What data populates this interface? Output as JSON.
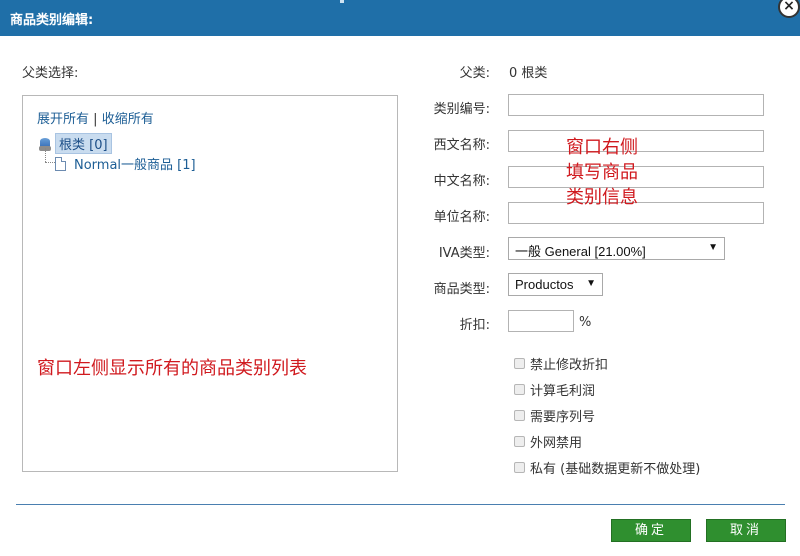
{
  "window": {
    "title": "商品类别编辑:",
    "close_label": "×"
  },
  "left": {
    "parent_select_label": "父类选择:",
    "expand_all": "展开所有",
    "separator": "|",
    "collapse_all": "收缩所有",
    "tree": {
      "root_label": "根类 [0]",
      "children": [
        {
          "label": "Normal一般商品 [1]"
        }
      ]
    },
    "note": "窗口左侧显示所有的商品类别列表"
  },
  "form": {
    "parent_label": "父类:",
    "parent_value": "0 根类",
    "code_label": "类别编号:",
    "code_value": "",
    "western_name_label": "西文名称:",
    "western_name_value": "",
    "chinese_name_label": "中文名称:",
    "chinese_name_value": "",
    "unit_label": "单位名称:",
    "unit_value": "",
    "iva_label": "IVA类型:",
    "iva_selected": "一般 General [21.00%]",
    "product_type_label": "商品类型:",
    "product_type_selected": "Productos",
    "discount_label": "折扣:",
    "discount_value": "",
    "percent_sign": "%",
    "note_line1": "窗口右侧",
    "note_line2": "填写商品",
    "note_line3": "类别信息",
    "checkboxes": [
      {
        "label": "禁止修改折扣",
        "checked": false
      },
      {
        "label": "计算毛利润",
        "checked": false
      },
      {
        "label": "需要序列号",
        "checked": false
      },
      {
        "label": "外网禁用",
        "checked": false
      },
      {
        "label": "私有 (基础数据更新不做处理)",
        "checked": false
      }
    ]
  },
  "buttons": {
    "confirm": "确定",
    "cancel": "取消"
  },
  "colors": {
    "titlebar": "#1f6fa8",
    "button": "#2f8f2f",
    "note": "#d0191e",
    "link": "#1d5e95"
  }
}
